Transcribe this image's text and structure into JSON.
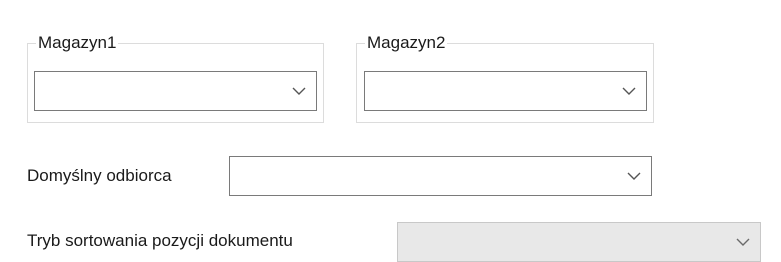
{
  "warehouse1": {
    "legend": "Magazyn1",
    "value": "",
    "arrow_icon": "chevron-down-icon"
  },
  "warehouse2": {
    "legend": "Magazyn2",
    "value": "",
    "arrow_icon": "chevron-down-icon"
  },
  "default_recipient": {
    "label": "Domyślny odbiorca",
    "value": "",
    "arrow_icon": "chevron-down-icon"
  },
  "sort_mode": {
    "label": "Tryb sortowania pozycji dokumentu",
    "value": "",
    "enabled": false,
    "arrow_icon": "chevron-down-icon"
  },
  "colors": {
    "combo_border": "#7a7a7a",
    "disabled_background": "#e8e8e8",
    "group_border": "#dcdcdc",
    "arrow": "#555555"
  }
}
